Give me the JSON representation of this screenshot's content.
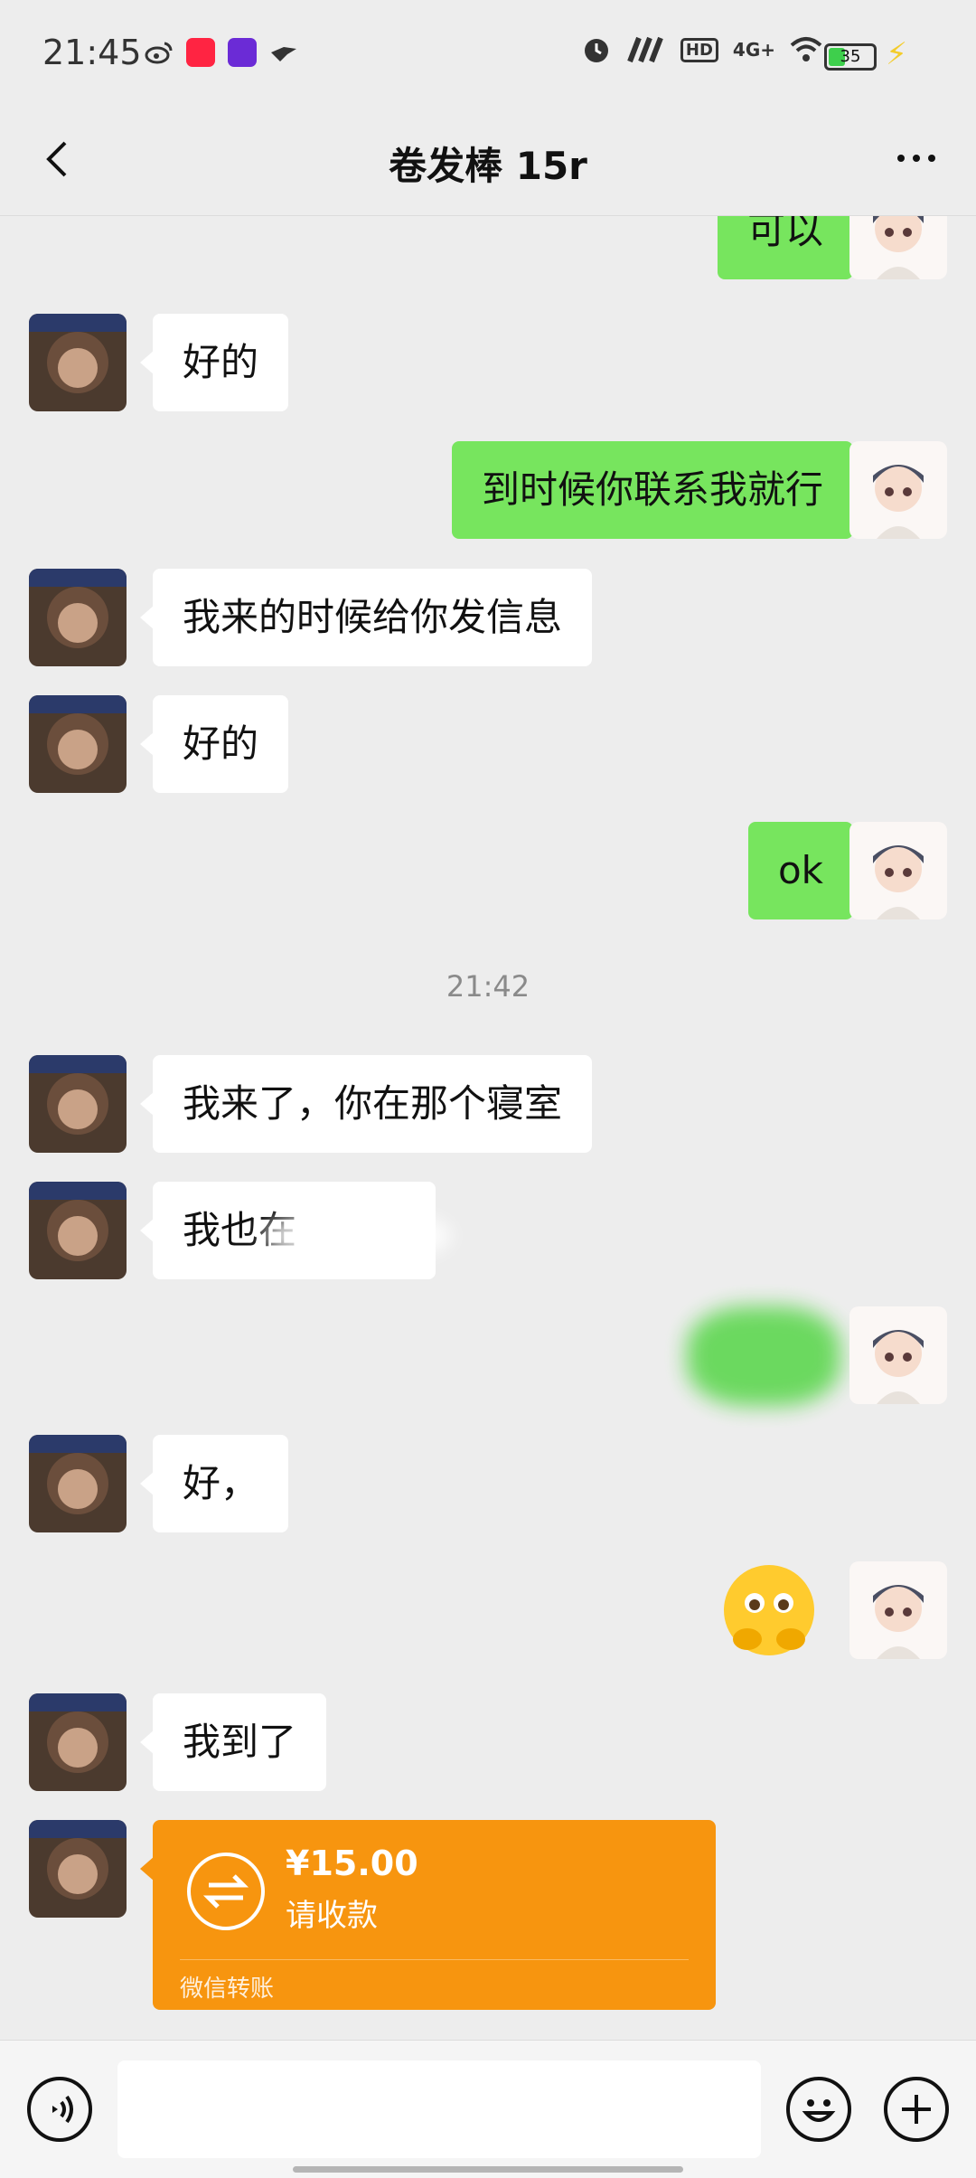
{
  "status_bar": {
    "time": "21:45",
    "network": "4G+",
    "battery": "35",
    "icons": [
      "weibo-icon",
      "xiaohongshu-icon",
      "video-app-icon",
      "bird-app-icon",
      "alarm-icon",
      "signal-icon",
      "hd-icon",
      "wifi-icon",
      "battery-icon",
      "charging-icon"
    ]
  },
  "nav": {
    "title": "卷发棒 15r",
    "back_icon": "chevron-left-icon",
    "more_icon": "more-dots-icon"
  },
  "messages": [
    {
      "side": "out",
      "text": "可以"
    },
    {
      "side": "in",
      "text": "好的"
    },
    {
      "side": "out",
      "text": "到时候你联系我就行"
    },
    {
      "side": "in",
      "text": "我来的时候给你发信息"
    },
    {
      "side": "in",
      "text": "好的"
    },
    {
      "side": "out",
      "text": "ok"
    },
    {
      "type": "timestamp",
      "text": "21:42"
    },
    {
      "side": "in",
      "text": "我来了，你在那个寝室"
    },
    {
      "side": "in",
      "text": "我也在"
    },
    {
      "side": "out",
      "text": ""
    },
    {
      "side": "in",
      "text": "好，"
    },
    {
      "side": "out",
      "type": "emoji",
      "icon": "shy-face-emoji"
    },
    {
      "side": "in",
      "text": "我到了"
    },
    {
      "side": "in",
      "type": "transfer"
    }
  ],
  "transfer": {
    "amount": "¥15.00",
    "status": "请收款",
    "footer": "微信转账"
  },
  "colors": {
    "background": "#ededed",
    "bubble_out": "#77e55e",
    "bubble_in": "#ffffff",
    "transfer": "#f7950f"
  },
  "input_bar": {
    "voice_icon": "voice-icon",
    "emoji_icon": "emoji-icon",
    "plus_icon": "plus-icon",
    "placeholder": ""
  }
}
